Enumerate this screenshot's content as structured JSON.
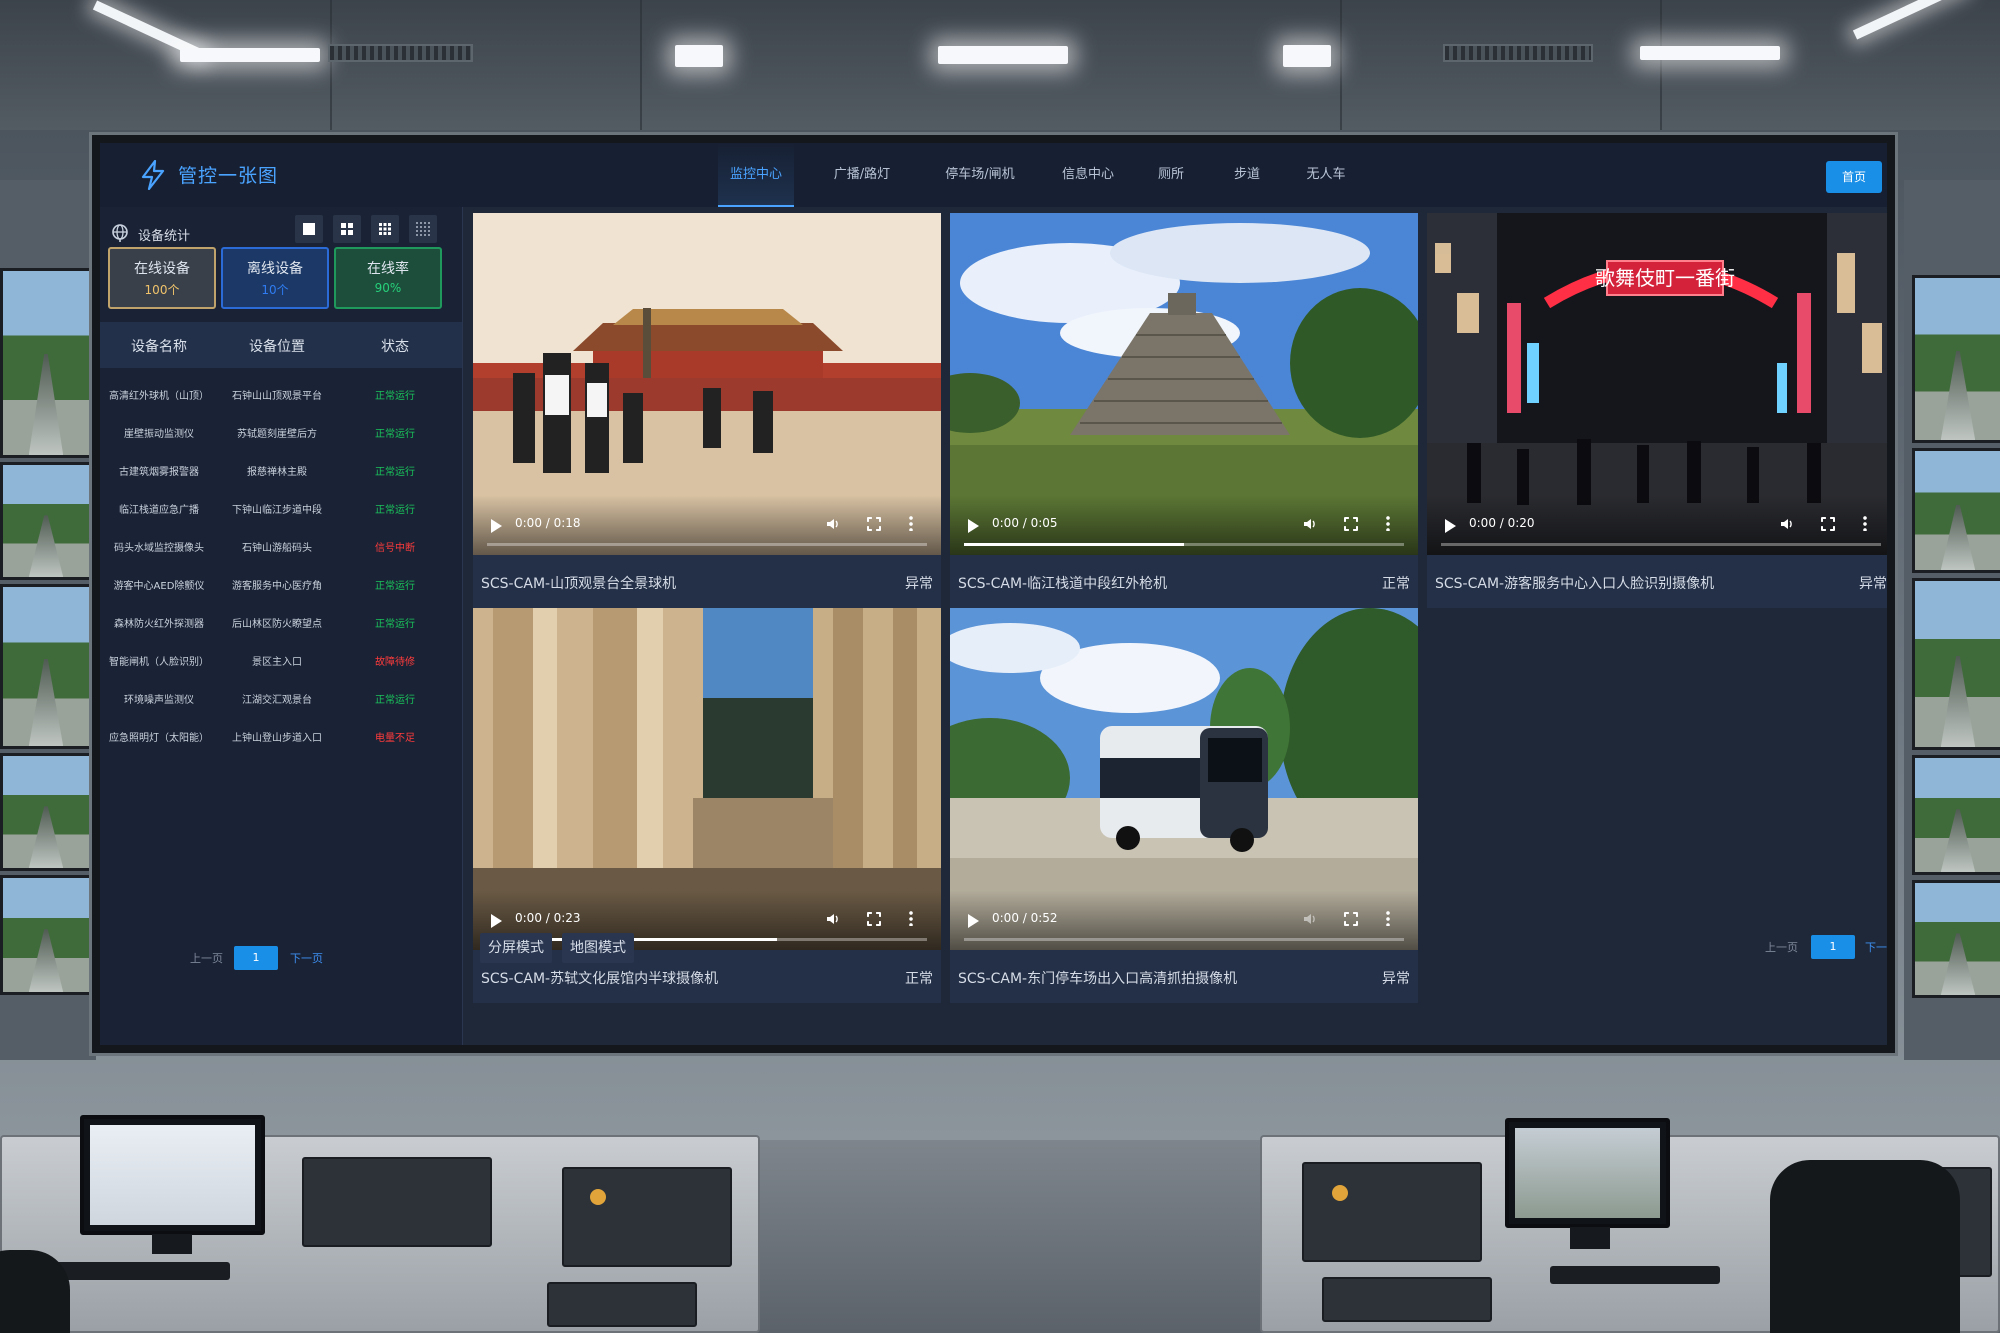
{
  "app": {
    "title": "管控一张图"
  },
  "nav": {
    "items": [
      "监控中心",
      "广播/路灯",
      "停车场/闸机",
      "信息中心",
      "厕所",
      "步道",
      "无人车"
    ],
    "active": "监控中心",
    "home": "首页"
  },
  "sidebar": {
    "title": "设备统计",
    "stats": [
      {
        "label": "在线设备",
        "value": "100个",
        "color": "#f0c36b"
      },
      {
        "label": "离线设备",
        "value": "10个",
        "color": "#2f7cf2"
      },
      {
        "label": "在线率",
        "value": "90%",
        "color": "#27d07a"
      }
    ],
    "columns": [
      "设备名称",
      "设备位置",
      "状态"
    ],
    "rows": [
      {
        "name": "高清红外球机（山顶）",
        "location": "石钟山山顶观景平台",
        "status": "正常运行",
        "status_color": "#19c45a"
      },
      {
        "name": "崖壁振动监测仪",
        "location": "苏轼题刻崖壁后方",
        "status": "正常运行",
        "status_color": "#19c45a"
      },
      {
        "name": "古建筑烟雾报警器",
        "location": "报慈禅林主殿",
        "status": "正常运行",
        "status_color": "#19c45a"
      },
      {
        "name": "临江栈道应急广播",
        "location": "下钟山临江步道中段",
        "status": "正常运行",
        "status_color": "#19c45a"
      },
      {
        "name": "码头水域监控摄像头",
        "location": "石钟山游船码头",
        "status": "信号中断",
        "status_color": "#ff3b3b"
      },
      {
        "name": "游客中心AED除颤仪",
        "location": "游客服务中心医疗角",
        "status": "正常运行",
        "status_color": "#19c45a"
      },
      {
        "name": "森林防火红外探测器",
        "location": "后山林区防火瞭望点",
        "status": "正常运行",
        "status_color": "#19c45a"
      },
      {
        "name": "智能闸机（人脸识别）",
        "location": "景区主入口",
        "status": "故障待修",
        "status_color": "#ff3b3b"
      },
      {
        "name": "环境噪声监测仪",
        "location": "江湖交汇观景台",
        "status": "正常运行",
        "status_color": "#19c45a"
      },
      {
        "name": "应急照明灯（太阳能）",
        "location": "上钟山登山步道入口",
        "status": "电量不足",
        "status_color": "#ff3b3b"
      }
    ],
    "pager": {
      "prev": "上一页",
      "page": "1",
      "next": "下一页"
    }
  },
  "videos": [
    {
      "name": "SCS-CAM-山顶观景台全景球机",
      "status": "异常",
      "time": "0:00 / 0:18",
      "progress": 0,
      "scene": "palace"
    },
    {
      "name": "SCS-CAM-临江栈道中段红外枪机",
      "status": "正常",
      "time": "0:00 / 0:05",
      "progress": 0.5,
      "scene": "pyramid"
    },
    {
      "name": "SCS-CAM-游客服务中心入口人脸识别摄像机",
      "status": "异常",
      "time": "0:00 / 0:20",
      "progress": 0,
      "scene": "street",
      "sign": "歌舞伎町一番街"
    },
    {
      "name": "SCS-CAM-苏轼文化展馆内半球摄像机",
      "status": "正常",
      "time": "0:00 / 0:23",
      "progress": 0.66,
      "scene": "ruins"
    },
    {
      "name": "SCS-CAM-东门停车场出入口高清抓拍摄像机",
      "status": "异常",
      "time": "0:00 / 0:52",
      "progress": 0,
      "scene": "bus"
    }
  ],
  "modes": [
    "分屏模式",
    "地图模式"
  ],
  "grid_pager": {
    "prev": "上一页",
    "page": "1",
    "next": "下一页"
  },
  "colors": {
    "accent": "#1a8fe8",
    "panel": "#1a2336",
    "normal": "#19c45a",
    "alert": "#ff3b3b"
  },
  "icons": [
    "bolt-icon",
    "globe-icon",
    "layout-1-icon",
    "layout-4-icon",
    "layout-9-icon",
    "layout-16-icon",
    "play-icon",
    "volume-icon",
    "fullscreen-icon",
    "more-icon"
  ]
}
